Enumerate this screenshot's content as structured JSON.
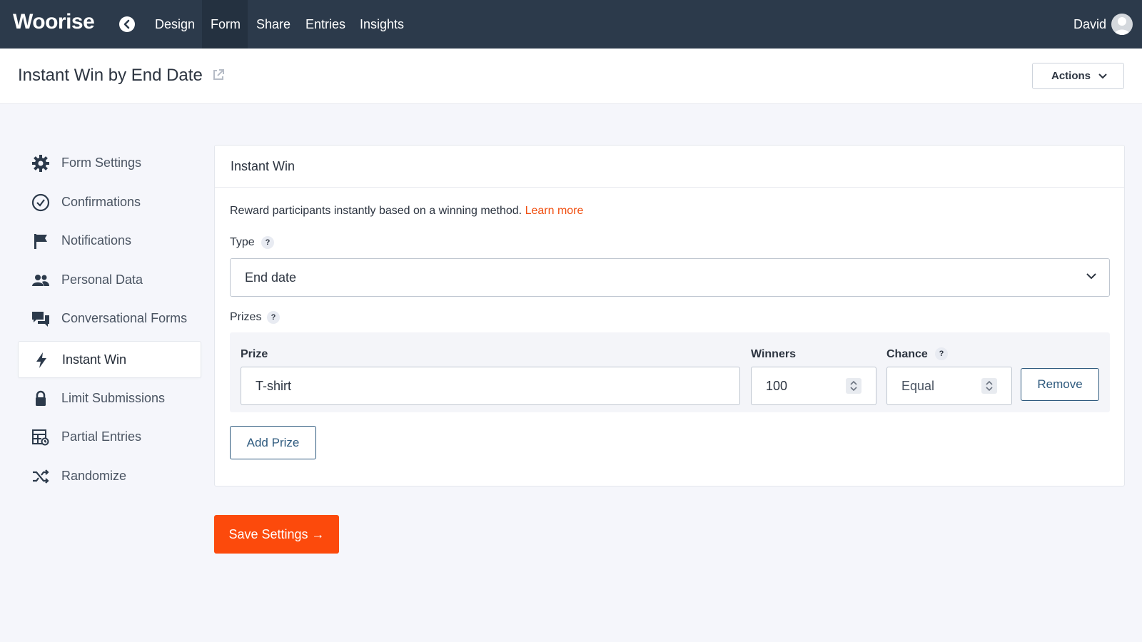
{
  "app": {
    "logo": "Woorise"
  },
  "nav": {
    "items": [
      {
        "label": "Design"
      },
      {
        "label": "Form",
        "active": true
      },
      {
        "label": "Share"
      },
      {
        "label": "Entries"
      },
      {
        "label": "Insights"
      }
    ],
    "user_name": "David"
  },
  "header": {
    "title": "Instant Win by End Date",
    "actions_label": "Actions"
  },
  "sidebar": {
    "items": [
      {
        "label": "Form Settings",
        "icon": "gear-icon"
      },
      {
        "label": "Confirmations",
        "icon": "check-circle-icon"
      },
      {
        "label": "Notifications",
        "icon": "flag-icon"
      },
      {
        "label": "Personal Data",
        "icon": "users-icon"
      },
      {
        "label": "Conversational Forms",
        "icon": "chat-icon"
      },
      {
        "label": "Instant Win",
        "icon": "bolt-icon",
        "active": true
      },
      {
        "label": "Limit Submissions",
        "icon": "lock-icon"
      },
      {
        "label": "Partial Entries",
        "icon": "table-icon"
      },
      {
        "label": "Randomize",
        "icon": "shuffle-icon"
      }
    ]
  },
  "panel": {
    "title": "Instant Win",
    "description": "Reward participants instantly based on a winning method.",
    "learn_more": "Learn more",
    "type_label": "Type",
    "type_value": "End date",
    "prizes_label": "Prizes",
    "help_glyph": "?",
    "columns": {
      "prize": "Prize",
      "winners": "Winners",
      "chance": "Chance"
    },
    "prize": {
      "name": "T-shirt",
      "winners": "100",
      "chance": "Equal"
    },
    "remove_label": "Remove",
    "add_prize_label": "Add Prize"
  },
  "save_label": "Save Settings →",
  "colors": {
    "topbar": "#2c3a4b",
    "accent": "#fc4a0c",
    "link": "#f04e0f",
    "outline_button": "#2e5a7e"
  }
}
